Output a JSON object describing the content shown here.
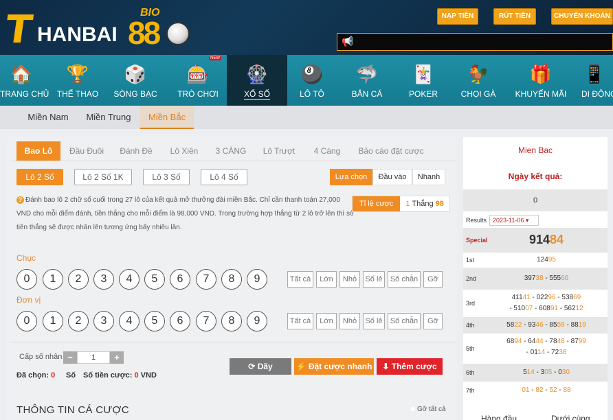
{
  "header": {
    "logo": {
      "text_t": "T",
      "text_hanbai": "HANBAI",
      "text_88": "88",
      "text_bio": "BIO"
    },
    "buttons": [
      "NẠP TIỀN",
      "RÚT TIỀN",
      "CHUYỂN KHOẢN"
    ],
    "marquee_icon": "megaphone-icon"
  },
  "nav": {
    "items": [
      {
        "label": "TRANG CHỦ",
        "icon": "house-icon"
      },
      {
        "label": "THỂ THAO",
        "icon": "trophy-icon"
      },
      {
        "label": "SÒNG BẠC",
        "icon": "dice-icon"
      },
      {
        "label": "TRÒ CHƠI",
        "icon": "slot-machine-icon",
        "tag": "NEW"
      },
      {
        "label": "XỔ SỐ",
        "icon": "lottery-drum-icon"
      },
      {
        "label": "LÔ TÔ",
        "icon": "lotto-balls-icon"
      },
      {
        "label": "BẮN CÁ",
        "icon": "fish-icon"
      },
      {
        "label": "POKER",
        "icon": "cards-icon"
      },
      {
        "label": "CHỌI GÀ",
        "icon": "rooster-icon"
      },
      {
        "label": "KHUYẾN MÃI",
        "icon": "gift-icon"
      },
      {
        "label": "DI ĐỘNG",
        "icon": "mobile-icon"
      }
    ]
  },
  "region_tabs": [
    "Miền Nam",
    "Miền Trung",
    "Miền Bắc"
  ],
  "game_tabs": [
    "Bao Lô",
    "Đầu Đuôi",
    "Đánh Đề",
    "Lô Xiên",
    "3 CÀNG",
    "Lô Trượt",
    "4 Càng",
    "Bảo cáo đặt cược"
  ],
  "lo_buttons": [
    "Lô 2 Số",
    "Lô 2 Số 1K",
    "Lô 3 Số",
    "Lô 4 Số"
  ],
  "mode_buttons": [
    "Lựa chọn",
    "Đầu vào",
    "Nhanh"
  ],
  "description": "Đánh bao lô 2 chữ số cuối trong 27 lô của kết quả mở thưởng đài miền Bắc. Chỉ cần thanh toán 27,000 VND cho mỗi điểm đánh, tiền thắng cho mỗi điểm là 98,000 VND. Trong trường hợp thắng từ 2 lô trở lên thì số tiền thắng sẽ được nhân lên tương ứng bấy nhiêu lần.",
  "rate": {
    "label": "Tỉ lệ cược",
    "prefix": "1",
    "middle": " Thắng ",
    "value": "98"
  },
  "sections": [
    {
      "label": "Chục",
      "numbers": [
        "0",
        "1",
        "2",
        "3",
        "4",
        "5",
        "6",
        "7",
        "8",
        "9"
      ]
    },
    {
      "label": "Đơn vị",
      "numbers": [
        "0",
        "1",
        "2",
        "3",
        "4",
        "5",
        "6",
        "7",
        "8",
        "9"
      ]
    }
  ],
  "quick_buttons": [
    "Tất cả",
    "Lớn",
    "Nhỏ",
    "Số lẻ",
    "Số chẵn",
    "Gỡ"
  ],
  "multiplier": {
    "label": "Cấp số nhân",
    "minus": "−",
    "value": "1",
    "plus": "+"
  },
  "summary": {
    "chosen_label": "Đã chọn:",
    "chosen_value": "0",
    "so_label": "Số",
    "amount_label": "Số tiền cược:",
    "amount_value": "0",
    "currency": "VND"
  },
  "actions": {
    "clear": "Dãy",
    "quick_bet": "Đặt cược nhanh",
    "add_bet": "Thêm cược"
  },
  "bet_info": {
    "title": "THÔNG TIN CÁ CƯỢC",
    "clear_all": "Gỡ tất cả"
  },
  "sidebar": {
    "title": "Mien Bac",
    "subtitle": "Ngày kết quả:",
    "zero": "0",
    "results_label": "Results",
    "date": "2023-11-06",
    "prizes": [
      {
        "label": "Special",
        "parts": [
          [
            "914",
            ""
          ],
          [
            "84",
            "hl"
          ]
        ]
      },
      {
        "label": "1st",
        "parts": [
          [
            "124",
            ""
          ],
          [
            "95",
            "hl"
          ]
        ]
      },
      {
        "label": "2nd",
        "parts": [
          [
            "397",
            ""
          ],
          [
            "38",
            "hl"
          ],
          [
            " - 555",
            ""
          ],
          [
            "66",
            "hl"
          ]
        ]
      },
      {
        "label": "3rd",
        "parts": [
          [
            "411",
            ""
          ],
          [
            "41",
            "hl"
          ],
          [
            " - 022",
            ""
          ],
          [
            "96",
            "hl"
          ],
          [
            " - 538",
            ""
          ],
          [
            "69",
            "hl"
          ],
          [
            "\n - 510",
            ""
          ],
          [
            "07",
            "hl"
          ],
          [
            " - 608",
            ""
          ],
          [
            "91",
            "hl"
          ],
          [
            " - 562",
            ""
          ],
          [
            "12",
            "hl"
          ]
        ]
      },
      {
        "label": "4th",
        "parts": [
          [
            "58",
            ""
          ],
          [
            "22",
            "hl"
          ],
          [
            " - 93",
            ""
          ],
          [
            "46",
            "hl"
          ],
          [
            " - 85",
            ""
          ],
          [
            "59",
            "hl"
          ],
          [
            " - 88",
            ""
          ],
          [
            "19",
            "hl"
          ]
        ]
      },
      {
        "label": "5th",
        "parts": [
          [
            "68",
            ""
          ],
          [
            "94",
            "hl"
          ],
          [
            " - 64",
            ""
          ],
          [
            "44",
            "hl"
          ],
          [
            " - 78",
            ""
          ],
          [
            "48",
            "hl"
          ],
          [
            " - 87",
            ""
          ],
          [
            "99",
            "hl"
          ],
          [
            "\n - 01",
            ""
          ],
          [
            "14",
            "hl"
          ],
          [
            " - 72",
            ""
          ],
          [
            "38",
            "hl"
          ]
        ]
      },
      {
        "label": "6th",
        "parts": [
          [
            "5",
            ""
          ],
          [
            "14",
            "hl"
          ],
          [
            " - 3",
            ""
          ],
          [
            "05",
            "hl"
          ],
          [
            " - 0",
            ""
          ],
          [
            "30",
            "hl"
          ]
        ]
      },
      {
        "label": "7th",
        "parts": [
          [
            "01",
            "hl"
          ],
          [
            " - ",
            ""
          ],
          [
            "82",
            "hl"
          ],
          [
            " - ",
            ""
          ],
          [
            "52",
            "hl"
          ],
          [
            " - ",
            ""
          ],
          [
            "88",
            "hl"
          ]
        ]
      }
    ],
    "footer": [
      "Hàng đầu",
      "Dưới cùng"
    ]
  }
}
